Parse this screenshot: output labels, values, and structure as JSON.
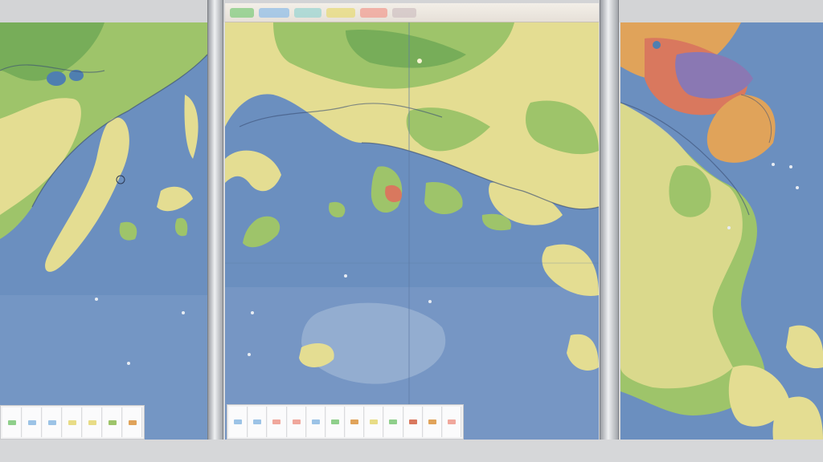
{
  "window": {
    "panel_count": 3,
    "background": "#d9dadc"
  },
  "colors": {
    "sea": "#6b8fbf",
    "sea_light": "#9fb6d6",
    "land_low": "#e4dd92",
    "land_green": "#9ec46a",
    "land_dark_green": "#6fa84e",
    "highland": "#e0a35a",
    "hot_zone": "#d9785e",
    "purple_zone": "#8a78b3",
    "coast_line": "#3a4f74"
  },
  "legend": {
    "left_tools": [
      "tool-1",
      "tool-2",
      "tool-3",
      "tool-4",
      "tool-5",
      "tool-6",
      "tool-7"
    ],
    "center_tools": [
      "tool-1",
      "tool-2",
      "tool-3",
      "tool-4",
      "tool-5",
      "tool-6",
      "tool-7",
      "tool-8",
      "tool-9",
      "tool-10",
      "tool-11",
      "tool-12"
    ]
  },
  "icons": [
    "map-marker-icon",
    "settings-icon",
    "layer-icon"
  ]
}
